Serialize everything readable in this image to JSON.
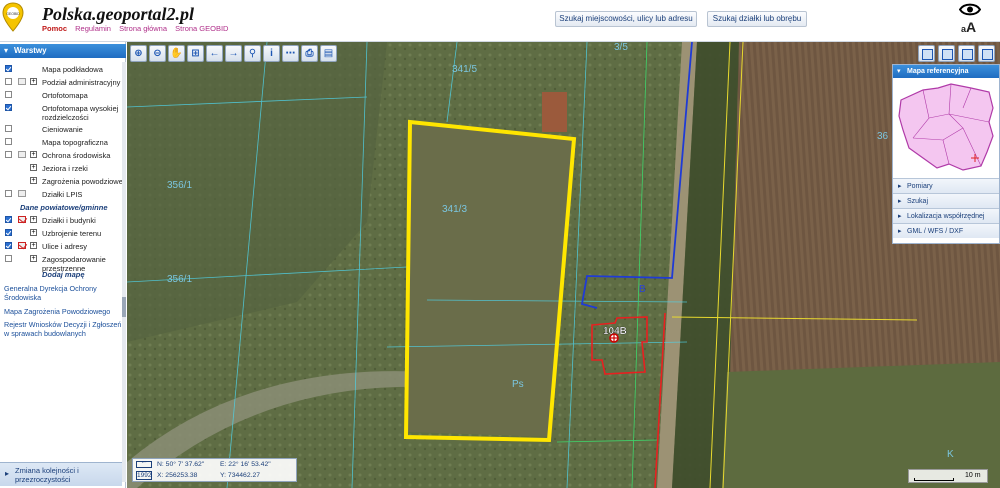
{
  "header": {
    "title": "Polska.geoportal2.pl",
    "links": [
      "Pomoc",
      "Regulamin",
      "Strona główna",
      "Strona GEOBID"
    ],
    "logo_text": "GEOBID",
    "search_address_label": "Szukaj miejscowości, ulicy lub adresu",
    "search_parcel_label": "Szukaj działki lub obrębu",
    "font_size_label": "aA"
  },
  "left_panel": {
    "title": "Warstwy",
    "layers": [
      {
        "label": "Mapa podkładowa",
        "checked": true,
        "expand": false,
        "icon": false
      },
      {
        "label": "Podział administracyjny",
        "checked": false,
        "expand": true,
        "icon": true
      },
      {
        "label": "Ortofotomapa",
        "checked": false,
        "expand": false,
        "icon": false
      },
      {
        "label": "Ortofotomapa wysokiej rozdzielczości",
        "checked": true,
        "expand": false,
        "icon": false
      },
      {
        "label": "Cieniowanie",
        "checked": false,
        "expand": false,
        "icon": false
      },
      {
        "label": "Mapa topograficzna",
        "checked": false,
        "expand": false,
        "icon": false
      },
      {
        "label": "Ochrona środowiska",
        "checked": false,
        "expand": true,
        "icon": true
      },
      {
        "label": "Jeziora i rzeki",
        "checked": false,
        "expand": true,
        "icon": false
      },
      {
        "label": "Zagrożenia powodziowe",
        "checked": false,
        "expand": true,
        "icon": false
      },
      {
        "label": "Działki LPIS",
        "checked": false,
        "expand": false,
        "icon": true
      }
    ],
    "section_title": "Dane powiatowe/gminne",
    "county_layers": [
      {
        "label": "Działki i budynki",
        "checked": true,
        "expand": true,
        "icon": true
      },
      {
        "label": "Uzbrojenie terenu",
        "checked": true,
        "expand": true,
        "icon": false
      },
      {
        "label": "Ulice i adresy",
        "checked": true,
        "expand": true,
        "icon": true
      },
      {
        "label": "Zagospodarowanie przestrzenne",
        "checked": false,
        "expand": true,
        "icon": false
      }
    ],
    "add_map_label": "Dodaj mapę",
    "provider_links": [
      "Generalna Dyrekcja Ochrony Środowiska",
      "Mapa Zagrożenia Powodziowego",
      "Rejestr Wniosków Decyzji i Zgłoszeń w sprawach budowlanych"
    ],
    "order_label": "Zmiana kolejności i przezroczystości"
  },
  "toolbar": {
    "tools": [
      "zoom-in-icon",
      "zoom-out-icon",
      "pan-hand-icon",
      "zoom-box-icon",
      "back-arrow-icon",
      "forward-arrow-icon",
      "link-icon",
      "info-icon",
      "measure-icon",
      "print-icon",
      "save-icon"
    ],
    "glyphs": [
      "⊕",
      "⊖",
      "✋",
      "⊞",
      "←",
      "→",
      "⚲",
      "i",
      "⋯",
      "⎙",
      "▤"
    ]
  },
  "map": {
    "parcel_labels": [
      "341/5",
      "341/3",
      "356/1",
      "356/1",
      "36",
      "104B",
      "B",
      "Ps",
      "K",
      "3/5"
    ],
    "marker_label": "104B",
    "highlight_color": "#ffe600"
  },
  "right_panel": {
    "title": "Mapa referencyjna",
    "items": [
      "Pomiary",
      "Szukaj",
      "Lokalizacja współrzędnej",
      "GML / WFS / DXF"
    ]
  },
  "coordinates": {
    "n": "N: 50° 7' 37.62\"",
    "e": "E: 22° 16' 53.42\"",
    "x": "X: 256253.38",
    "y": "Y: 734462.27",
    "epsg": "1992"
  },
  "scale": {
    "label": "10 m"
  }
}
